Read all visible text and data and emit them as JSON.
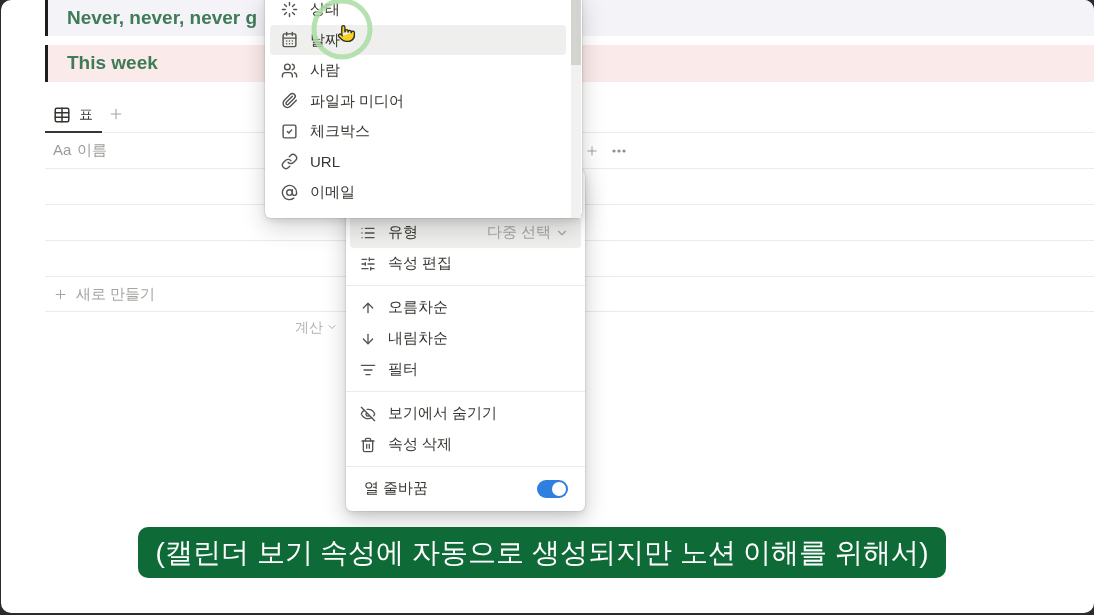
{
  "callouts": [
    {
      "text": "Never, never, never g",
      "color": "#f4f3f8"
    },
    {
      "text": "This week",
      "color": "#fbeaea"
    }
  ],
  "view_tabs": [
    {
      "label": "표",
      "selected": true
    }
  ],
  "table": {
    "columns": [
      {
        "type_icon": "Aa",
        "label": "이름"
      }
    ],
    "new_row": "새로 만들기",
    "calculate": "계산"
  },
  "type_menu": {
    "items": [
      {
        "kind": "status",
        "label": "상태",
        "selected": false
      },
      {
        "kind": "date",
        "label": "날짜",
        "selected": true
      },
      {
        "kind": "person",
        "label": "사람",
        "selected": false
      },
      {
        "kind": "file",
        "label": "파일과 미디어",
        "selected": false
      },
      {
        "kind": "checkbox",
        "label": "체크박스",
        "selected": false
      },
      {
        "kind": "url",
        "label": "URL",
        "selected": false
      },
      {
        "kind": "email",
        "label": "이메일",
        "selected": false
      }
    ]
  },
  "property_menu": {
    "sections": [
      {
        "items": [
          {
            "kind": "type",
            "label": "유형",
            "value": "다중 선택",
            "selected": true
          },
          {
            "kind": "edit",
            "label": "속성 편집",
            "selected": false
          }
        ]
      },
      {
        "items": [
          {
            "kind": "sort_asc",
            "label": "오름차순",
            "selected": false
          },
          {
            "kind": "sort_desc",
            "label": "내림차순",
            "selected": false
          },
          {
            "kind": "filter",
            "label": "필터",
            "selected": false
          }
        ]
      },
      {
        "items": [
          {
            "kind": "hide",
            "label": "보기에서 숨기기",
            "selected": false
          },
          {
            "kind": "delete",
            "label": "속성 삭제",
            "selected": false
          }
        ]
      },
      {
        "items": [
          {
            "kind": "toggle",
            "label": "열 줄바꿈",
            "on": true
          }
        ]
      }
    ]
  },
  "caption": "(캘린더 보기 속성에 자동으로 생성되지만 노션 이해를 위해서)"
}
